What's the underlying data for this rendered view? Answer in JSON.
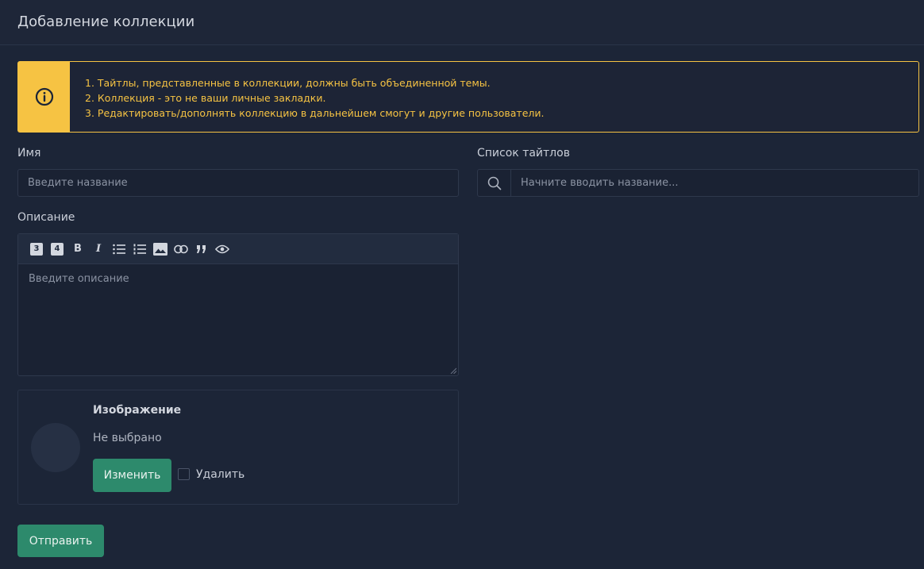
{
  "header": {
    "title": "Добавление коллекции"
  },
  "alert": {
    "icon": "info-icon",
    "accent_color": "#f6c343",
    "lines": [
      "1. Тайтлы, представленные в коллекции, должны быть объединенной темы.",
      "2. Коллекция - это не ваши личные закладки.",
      "3. Редактировать/дополнять коллекцию в дальнейшем смогут и другие пользователи."
    ]
  },
  "name_field": {
    "label": "Имя",
    "placeholder": "Введите название"
  },
  "titles_field": {
    "label": "Список тайтлов",
    "placeholder": "Начните вводить название...",
    "icon": "search-icon"
  },
  "description": {
    "label": "Описание",
    "placeholder": "Введите описание",
    "toolbar": {
      "heading3": "3",
      "heading4": "4",
      "bold": "B",
      "italic": "I"
    }
  },
  "image": {
    "title": "Изображение",
    "status": "Не выбрано",
    "change_button": "Изменить",
    "delete_label": "Удалить"
  },
  "submit_button": "Отправить",
  "colors": {
    "background": "#1c2537",
    "primary_button": "#2d8a6c",
    "warning": "#f6c343"
  }
}
